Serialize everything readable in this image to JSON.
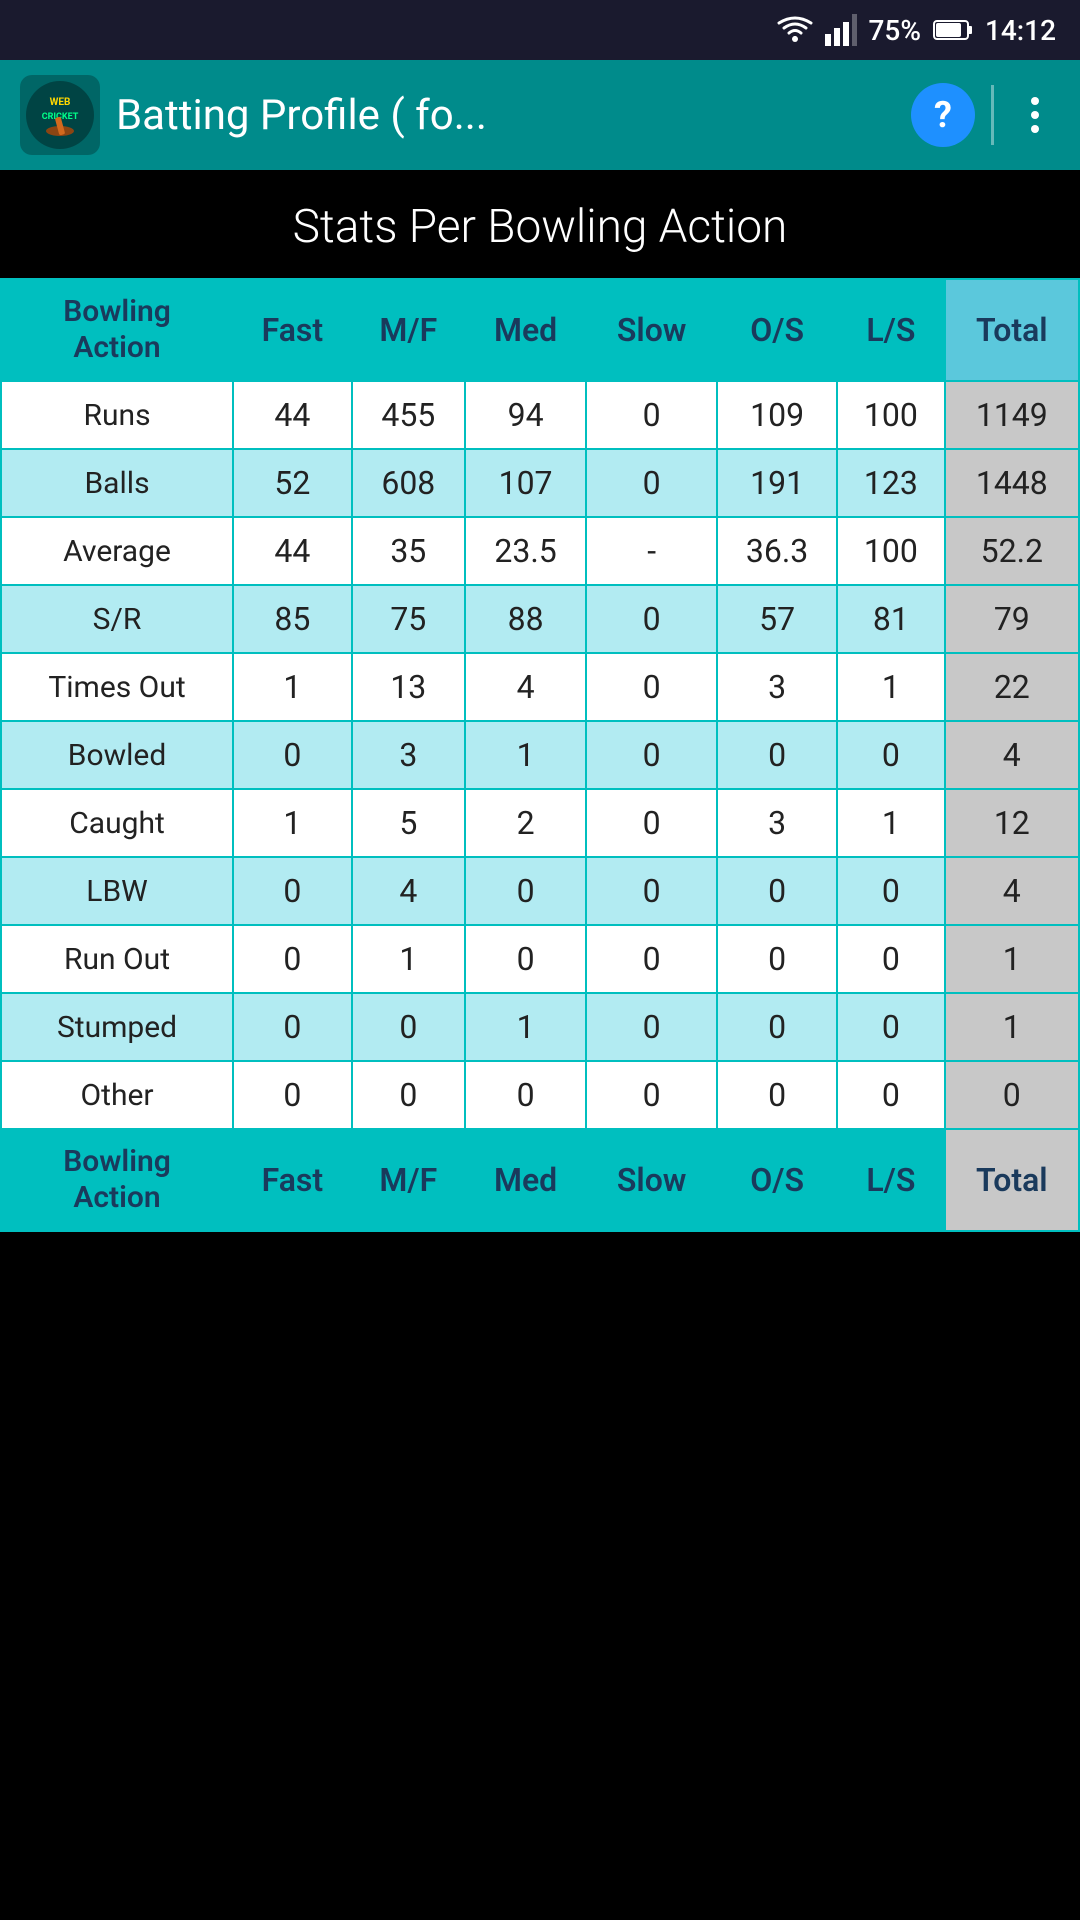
{
  "statusBar": {
    "battery": "75%",
    "time": "14:12"
  },
  "appBar": {
    "title": "Batting Profile ( fo...",
    "helpLabel": "?",
    "logoText": "WEB CRICKET"
  },
  "sectionHeader": {
    "title": "Stats Per Bowling Action"
  },
  "table": {
    "headers": [
      "Bowling Action",
      "Fast",
      "M/F",
      "Med",
      "Slow",
      "O/S",
      "L/S",
      "Total"
    ],
    "rows": [
      {
        "label": "Runs",
        "fast": "44",
        "mf": "455",
        "med": "94",
        "slow": "0",
        "os": "109",
        "ls": "100",
        "total": "1149",
        "alt": false
      },
      {
        "label": "Balls",
        "fast": "52",
        "mf": "608",
        "med": "107",
        "slow": "0",
        "os": "191",
        "ls": "123",
        "total": "1448",
        "alt": true
      },
      {
        "label": "Average",
        "fast": "44",
        "mf": "35",
        "med": "23.5",
        "slow": "-",
        "os": "36.3",
        "ls": "100",
        "total": "52.2",
        "alt": false
      },
      {
        "label": "S/R",
        "fast": "85",
        "mf": "75",
        "med": "88",
        "slow": "0",
        "os": "57",
        "ls": "81",
        "total": "79",
        "alt": true
      },
      {
        "label": "Times Out",
        "fast": "1",
        "mf": "13",
        "med": "4",
        "slow": "0",
        "os": "3",
        "ls": "1",
        "total": "22",
        "alt": false
      },
      {
        "label": "Bowled",
        "fast": "0",
        "mf": "3",
        "med": "1",
        "slow": "0",
        "os": "0",
        "ls": "0",
        "total": "4",
        "alt": true
      },
      {
        "label": "Caught",
        "fast": "1",
        "mf": "5",
        "med": "2",
        "slow": "0",
        "os": "3",
        "ls": "1",
        "total": "12",
        "alt": false
      },
      {
        "label": "LBW",
        "fast": "0",
        "mf": "4",
        "med": "0",
        "slow": "0",
        "os": "0",
        "ls": "0",
        "total": "4",
        "alt": true
      },
      {
        "label": "Run Out",
        "fast": "0",
        "mf": "1",
        "med": "0",
        "slow": "0",
        "os": "0",
        "ls": "0",
        "total": "1",
        "alt": false
      },
      {
        "label": "Stumped",
        "fast": "0",
        "mf": "0",
        "med": "1",
        "slow": "0",
        "os": "0",
        "ls": "0",
        "total": "1",
        "alt": true
      },
      {
        "label": "Other",
        "fast": "0",
        "mf": "0",
        "med": "0",
        "slow": "0",
        "os": "0",
        "ls": "0",
        "total": "0",
        "alt": false
      }
    ],
    "footer": [
      "Bowling Action",
      "Fast",
      "M/F",
      "Med",
      "Slow",
      "O/S",
      "L/S",
      "Total"
    ]
  }
}
